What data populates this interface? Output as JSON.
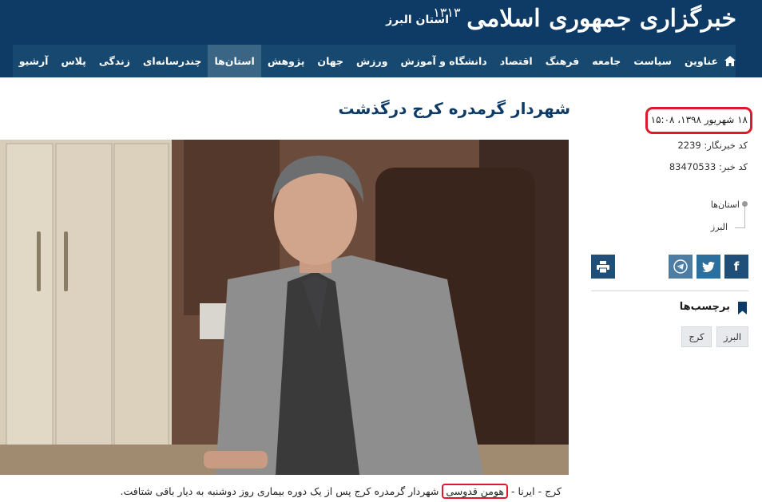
{
  "header": {
    "logo_text": "خبرگزاری جمهوری اسلامی",
    "logo_number": "۱۳۱۳",
    "province": "استان البرز"
  },
  "nav": {
    "home_icon": "home-icon",
    "items": [
      {
        "label": "عناوین",
        "active": false
      },
      {
        "label": "سیاست",
        "active": false
      },
      {
        "label": "جامعه",
        "active": false
      },
      {
        "label": "فرهنگ",
        "active": false
      },
      {
        "label": "اقتصاد",
        "active": false
      },
      {
        "label": "دانشگاه و آموزش",
        "active": false
      },
      {
        "label": "ورزش",
        "active": false
      },
      {
        "label": "جهان",
        "active": false
      },
      {
        "label": "پژوهش",
        "active": false
      },
      {
        "label": "استان‌ها",
        "active": true
      },
      {
        "label": "چندرسانه‌ای",
        "active": false
      },
      {
        "label": "زندگی",
        "active": false
      },
      {
        "label": "پلاس",
        "active": false
      },
      {
        "label": "آرشیو",
        "active": false
      }
    ]
  },
  "article": {
    "headline": "شهردار گرمدره کرج درگذشت",
    "caption_start": "کرج - ایرنا - ",
    "caption_name": "هومن قدوسی",
    "caption_end": " شهردار گرمدره کرج پس از یک دوره بیماری روز دوشنبه به دیار باقی شتافت."
  },
  "meta": {
    "date": "۱۸ شهریور ۱۳۹۸، ۱۵:۰۸",
    "reporter_code": "کد خبرنگار: 2239",
    "news_code": "کد خبر: 83470533"
  },
  "breadcrumb": {
    "level1": "استان‌ها",
    "level2": "البرز"
  },
  "share": {
    "facebook": "f",
    "twitter": "twitter-icon",
    "telegram": "telegram-icon",
    "print": "print-icon"
  },
  "tags": {
    "title": "برچسب‌ها",
    "items": [
      "البرز",
      "کرج"
    ]
  },
  "colors": {
    "header_bg": "#0d3b66",
    "nav_bg": "#17486f",
    "nav_active": "#3a6585",
    "highlight": "#e0182c"
  }
}
